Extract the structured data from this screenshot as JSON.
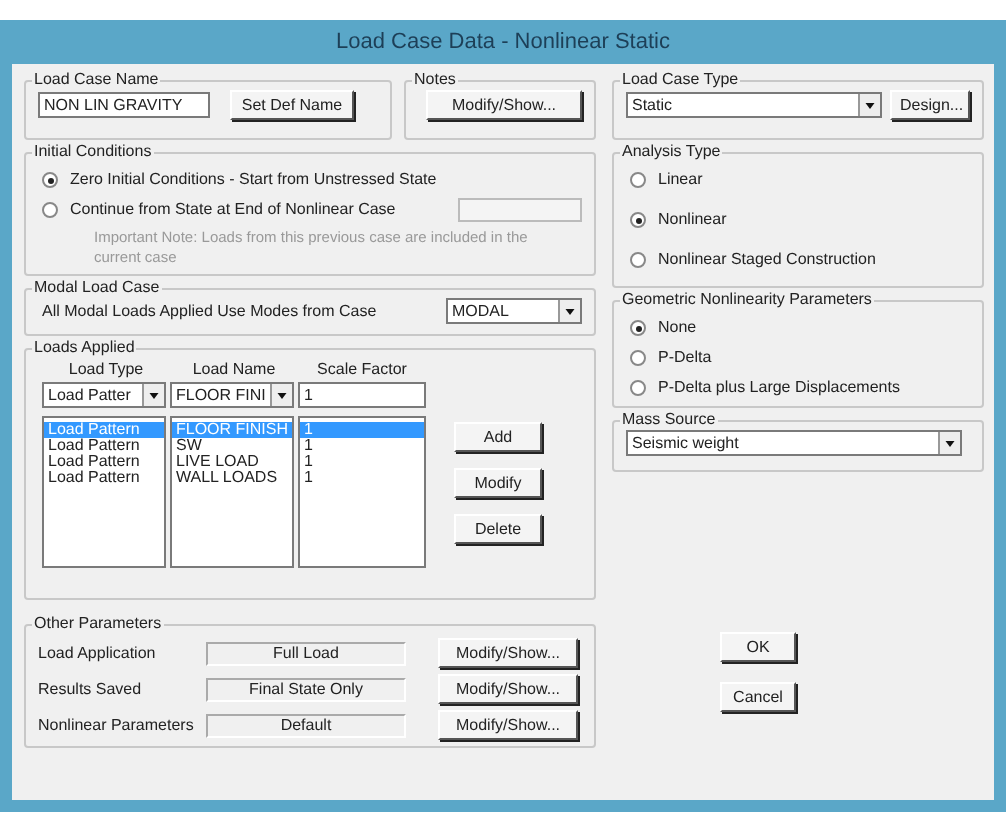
{
  "window": {
    "title": "Load Case Data - Nonlinear Static"
  },
  "load_case_name": {
    "label": "Load Case Name",
    "value": "NON LIN GRAVITY",
    "button": "Set Def Name"
  },
  "notes": {
    "label": "Notes",
    "button": "Modify/Show..."
  },
  "initial_conditions": {
    "label": "Initial Conditions",
    "options": [
      {
        "label": "Zero Initial Conditions - Start from Unstressed State",
        "selected": true
      },
      {
        "label": "Continue from State at End of Nonlinear Case",
        "selected": false
      }
    ],
    "note": "Important Note:   Loads from this previous case are included in the current case"
  },
  "modal_load_case": {
    "label": "Modal Load Case",
    "text": "All Modal Loads Applied Use Modes from Case",
    "value": "MODAL"
  },
  "loads_applied": {
    "label": "Loads Applied",
    "columns": [
      "Load Type",
      "Load Name",
      "Scale Factor"
    ],
    "input": {
      "load_type": "Load Patter",
      "load_name": "FLOOR FINI",
      "scale_factor": "1"
    },
    "rows": [
      {
        "load_type": "Load Pattern",
        "load_name": "FLOOR FINISH",
        "scale_factor": "1",
        "selected": true
      },
      {
        "load_type": "Load Pattern",
        "load_name": "SW",
        "scale_factor": "1",
        "selected": false
      },
      {
        "load_type": "Load Pattern",
        "load_name": "LIVE LOAD",
        "scale_factor": "1",
        "selected": false
      },
      {
        "load_type": "Load Pattern",
        "load_name": "WALL LOADS",
        "scale_factor": "1",
        "selected": false
      }
    ],
    "buttons": [
      "Add",
      "Modify",
      "Delete"
    ]
  },
  "other_parameters": {
    "label": "Other Parameters",
    "rows": [
      {
        "label": "Load Application",
        "value": "Full Load",
        "button": "Modify/Show..."
      },
      {
        "label": "Results Saved",
        "value": "Final State Only",
        "button": "Modify/Show..."
      },
      {
        "label": "Nonlinear Parameters",
        "value": "Default",
        "button": "Modify/Show..."
      }
    ]
  },
  "load_case_type": {
    "label": "Load Case Type",
    "value": "Static",
    "button": "Design..."
  },
  "analysis_type": {
    "label": "Analysis Type",
    "options": [
      {
        "label": "Linear",
        "selected": false
      },
      {
        "label": "Nonlinear",
        "selected": true
      },
      {
        "label": "Nonlinear Staged Construction",
        "selected": false
      }
    ]
  },
  "geometric_nonlinearity": {
    "label": "Geometric Nonlinearity Parameters",
    "options": [
      {
        "label": "None",
        "selected": true
      },
      {
        "label": "P-Delta",
        "selected": false
      },
      {
        "label": "P-Delta plus Large Displacements",
        "selected": false
      }
    ]
  },
  "mass_source": {
    "label": "Mass Source",
    "value": "Seismic weight"
  },
  "buttons": [
    "OK",
    "Cancel"
  ]
}
